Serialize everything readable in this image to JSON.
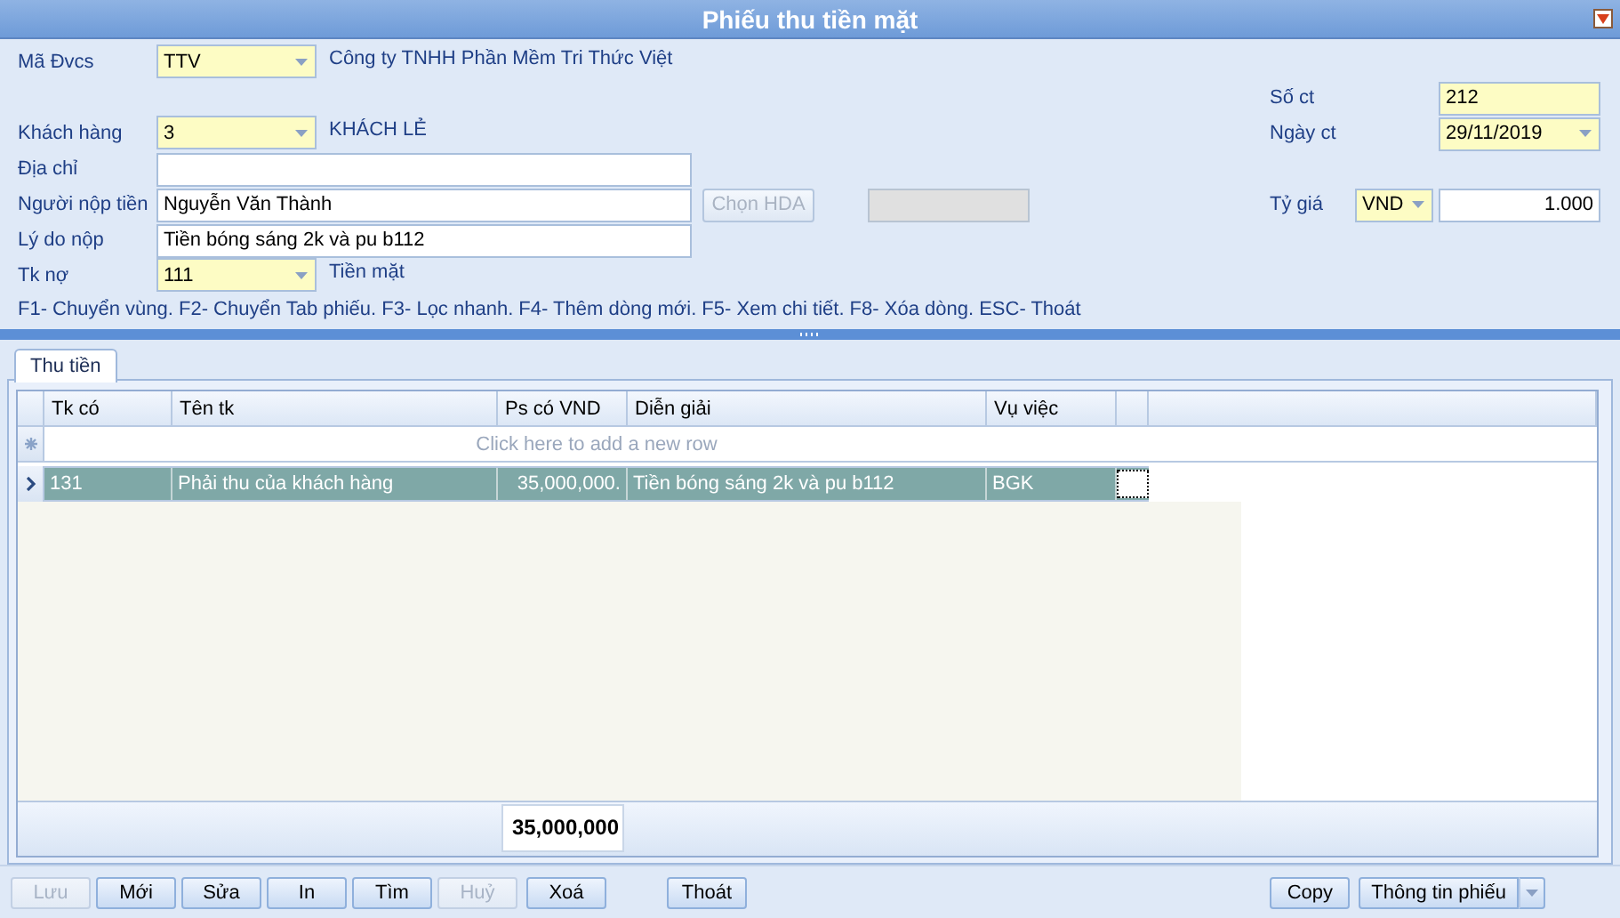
{
  "window": {
    "title": "Phiếu thu tiền mặt"
  },
  "header": {
    "ma_dvcs": {
      "label": "Mã Đvcs",
      "value": "TTV",
      "name": "Công ty TNHH Phần Mềm Tri Thức Việt"
    },
    "so_ct": {
      "label": "Số ct",
      "value": "212"
    },
    "khach_hang": {
      "label": "Khách hàng",
      "value": "3",
      "name": "KHÁCH LẺ"
    },
    "ngay_ct": {
      "label": "Ngày ct",
      "value": "29/11/2019"
    },
    "dia_chi": {
      "label": "Địa chỉ"
    },
    "nguoi_nop_tien": {
      "label": "Người nộp tiền",
      "value": "Nguyễn Văn Thành"
    },
    "chon_hda": {
      "label": "Chọn HDA",
      "disabled": true
    },
    "ty_gia": {
      "label": "Tỷ giá",
      "currency": "VND",
      "rate": "1.000"
    },
    "ly_do_nop": {
      "label": "Lý do nộp",
      "value": "Tiền bóng sáng 2k và pu b112"
    },
    "tk_no": {
      "label": "Tk nợ",
      "value": "111",
      "name": "Tiền mặt"
    },
    "hint": "F1- Chuyển vùng. F2- Chuyển Tab phiếu. F3- Lọc nhanh. F4- Thêm dòng mới. F5- Xem chi tiết. F8- Xóa dòng. ESC- Thoát"
  },
  "tabs": [
    {
      "label": "Thu tiền",
      "selected": true
    }
  ],
  "table": {
    "columns": [
      "Tk có",
      "Tên tk",
      "Ps có VND",
      "Diễn giải",
      "Vụ việc"
    ],
    "new_row_hint": "Click here to add a new row",
    "rows": [
      {
        "cells": [
          "131",
          "Phải thu của khách hàng",
          "35,000,000.",
          "Tiền bóng sáng 2k và pu b112",
          "BGK"
        ],
        "selected": true
      }
    ],
    "total": "35,000,000"
  },
  "buttons": [
    {
      "label": "Lưu",
      "disabled": true
    },
    {
      "label": "Mới",
      "disabled": false
    },
    {
      "label": "Sửa",
      "disabled": false
    },
    {
      "label": "In",
      "disabled": false
    },
    {
      "label": "Tìm",
      "disabled": false
    },
    {
      "label": "Huỷ",
      "disabled": true
    },
    {
      "label": "Xoá",
      "disabled": false
    },
    {
      "label": "Thoát",
      "disabled": false
    }
  ],
  "right_buttons": [
    {
      "label": "Copy",
      "kind": "plain"
    },
    {
      "label": "Thông tin phiếu",
      "kind": "split"
    }
  ]
}
